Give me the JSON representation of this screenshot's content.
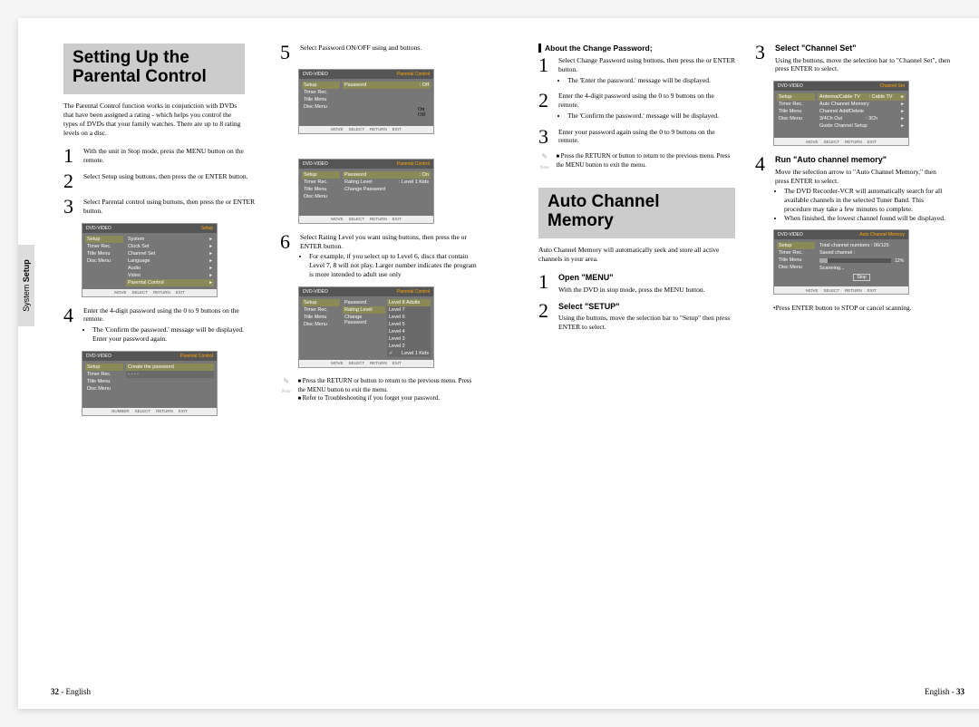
{
  "sidebar": {
    "label_plain": "System ",
    "label_bold": "Setup"
  },
  "footer": {
    "left": "32 - English",
    "right": "English - 33"
  },
  "leftPage": {
    "title": "Setting Up the Parental Control",
    "intro": "The Parental Control function works in conjunction with DVDs that have been assigned a rating - which helps you control the types of DVDs that your family watches. There are up to 8 rating levels on a disc.",
    "steps": {
      "s1": "With the unit in Stop mode, press the MENU button on the remote.",
      "s2": "Select Setup using             buttons, then press the       or ENTER button.",
      "s3": "Select Parental control using           buttons, then press the       or ENTER button.",
      "s4a": "Enter the 4-digit password using the 0 to 9 buttons on the remote.",
      "s4b": "The 'Confirm the password.' message will be displayed. Enter your password again.",
      "s5": "Select Password ON/OFF using         and         buttons.",
      "s6a": "Select Rating Level you want using           buttons, then press the       or ENTER button.",
      "s6b": "For example, if you select up to Level 6, discs that contain Level 7, 8 will not play. Larger number indicates the program is more intended to adult use only"
    },
    "note": {
      "n1": "Press the RETURN or       button to return to the previous menu. Press the MENU button to exit the menu.",
      "n2": "Refer to Troubleshooting if you forget your password."
    },
    "onoff": {
      "on": "On",
      "off": "Off"
    }
  },
  "rightPage": {
    "aboutTitle": "About the Change Password;",
    "about": {
      "s1a": "Select Change Password using           buttons, then press the       or ENTER button.",
      "s1b": "The 'Enter the password.' message will be displayed.",
      "s2a": "Enter the 4-digit password using the 0 to 9 buttons on the remote.",
      "s2b": "The 'Confirm the password.' message will be displayed.",
      "s3": "Enter your password again using the 0 to 9 buttons on the remote."
    },
    "aboutNote": "Press the RETURN or       button to return to the previous menu. Press the MENU button to exit the menu.",
    "autoTitle": "Auto Channel Memory",
    "autoIntro": "Auto Channel Memory will automatically seek and store all active channels in your area.",
    "autoSteps": {
      "s1h": "Open \"MENU\"",
      "s1": "With the DVD in stop mode, press the MENU button.",
      "s2h": "Select \"SETUP\"",
      "s2": "Using the           buttons, move the selection bar to \"Setup\" then press ENTER to select.",
      "s3h": "Select \"Channel Set\"",
      "s3": "Using the           buttons, move the selection bar to \"Channel Set\", then press ENTER to select.",
      "s4h": "Run \"Auto channel memory\"",
      "s4": "Move the selection arrow to \"Auto Channel Memory,\" then press ENTER to select.",
      "s4b1": "The DVD Recorder-VCR will automatically search for all available channels in the selected Tuner Band. This procedure may take a few minutes to complete.",
      "s4b2": "When finished, the lowest channel found will be displayed.",
      "s4note": "Press ENTER button to STOP or cancel scanning."
    }
  },
  "screens": {
    "nav": [
      "MOVE",
      "SELECT",
      "RETURN",
      "EXIT"
    ],
    "navNum": [
      "NUMBER",
      "SELECT",
      "RETURN",
      "EXIT"
    ],
    "sideMenu": [
      "Setup",
      "Timer Rec.",
      "Title Menu",
      "Disc Menu"
    ],
    "setup": {
      "title": "DVD-VIDEO",
      "head": "Setup",
      "items": [
        "System",
        "Clock Set",
        "Channel Set",
        "Language",
        "Audio",
        "Video",
        "Parental Control"
      ]
    },
    "parental": {
      "head": "Parental Control",
      "password": "Password",
      "rating": "Rating Level",
      "change": "Change Password",
      "on": ": On",
      "off": ": Off",
      "lvl1": ": Level 1 Kids",
      "create": "Create the password"
    },
    "levels": [
      "Level 8 Adults",
      "Level 7",
      "Level 6",
      "Level 5",
      "Level 4",
      "Level 3",
      "Level 2",
      "Level 1 Kids"
    ],
    "channelSet": {
      "head": "Channel Set",
      "items": [
        "Antenna/Cable TV",
        "Auto Channel Memory",
        "Channel Add/Delete",
        "3/4Ch Out",
        "Guide Channel Setup"
      ],
      "vals": [
        ": Cable TV",
        "",
        "",
        ": 3Ch",
        ""
      ]
    },
    "autoMem": {
      "head": "Auto Channel Memory",
      "total": "Total channel numbers :   06/125",
      "saved": "Saved channel :",
      "pct": "12%",
      "scanning": "Scanning...",
      "stop": "Stop"
    }
  }
}
